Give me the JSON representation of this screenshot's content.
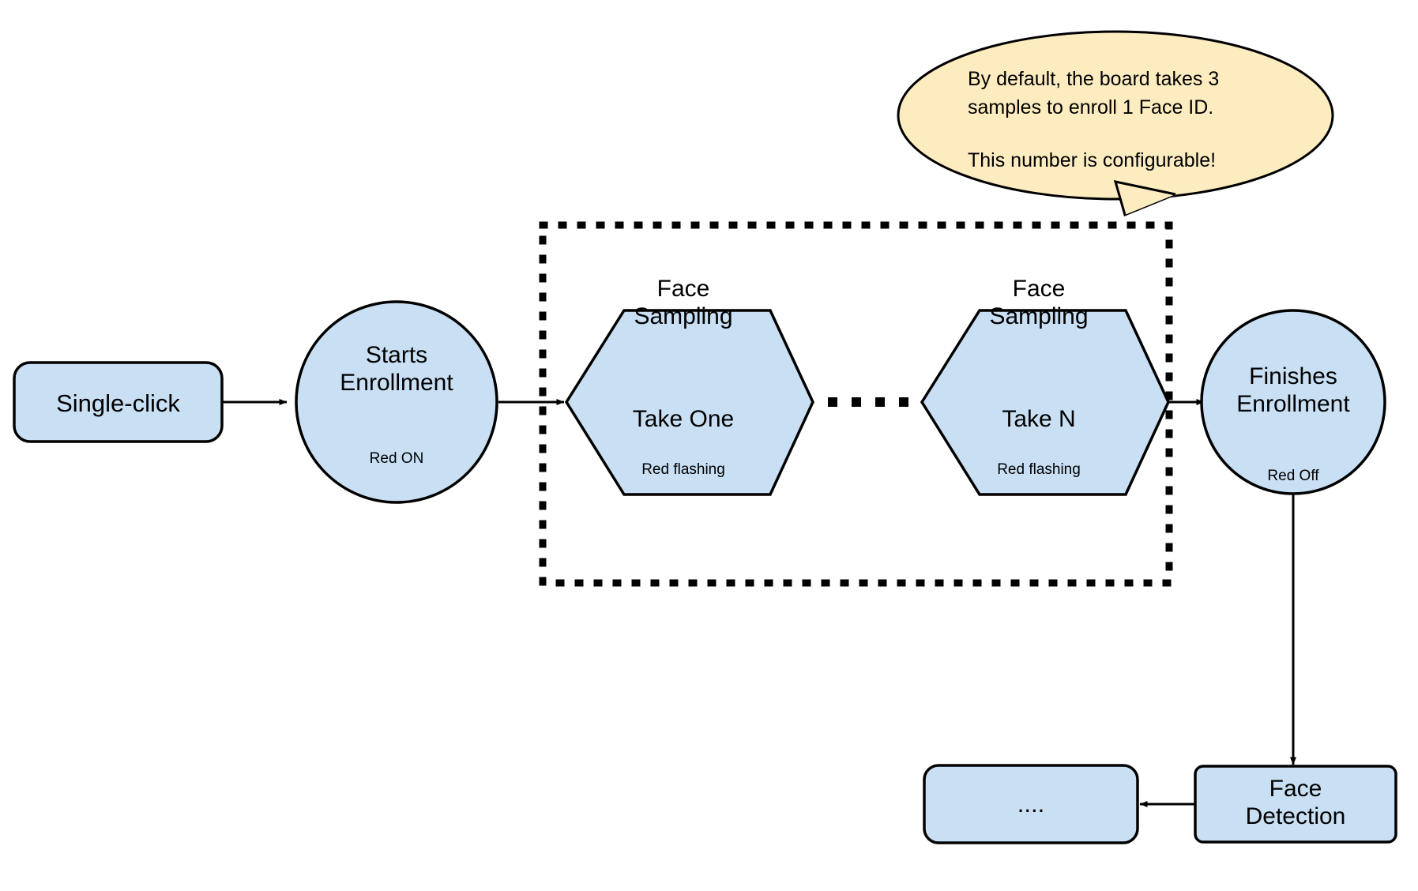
{
  "diagram": {
    "title": "Face ID enrollment flow",
    "colors": {
      "shape_fill": "#c9dff3",
      "shape_stroke": "#000000",
      "callout_fill": "#fdecc0",
      "callout_stroke": "#000000",
      "background": "#ffffff",
      "arrow": "#000000"
    },
    "nodes": {
      "single_click": {
        "label": "Single-click",
        "shape": "rounded-rect"
      },
      "starts_enrollment": {
        "title": "Starts\nEnrollment",
        "status": "Red ON",
        "shape": "circle"
      },
      "face_sampling_one": {
        "title": "Face\nSampling",
        "take": "Take One",
        "status": "Red flashing",
        "shape": "hexagon"
      },
      "face_sampling_n": {
        "title": "Face\nSampling",
        "take": "Take N",
        "status": "Red flashing",
        "shape": "hexagon"
      },
      "finishes_enrollment": {
        "title": "Finishes\nEnrollment",
        "status": "Red Off",
        "shape": "circle"
      },
      "face_detection": {
        "label": "Face\nDetection",
        "shape": "rounded-rect"
      },
      "continuation": {
        "label": "....",
        "shape": "rounded-rect"
      }
    },
    "ellipsis_between_samples": "• • • •",
    "callout": {
      "line1": "By default, the board takes 3",
      "line2": "samples to enroll 1 Face ID.",
      "line3": "This number is configurable!"
    },
    "grouping_box": {
      "style": "dotted",
      "description": "sampling loop region"
    }
  }
}
